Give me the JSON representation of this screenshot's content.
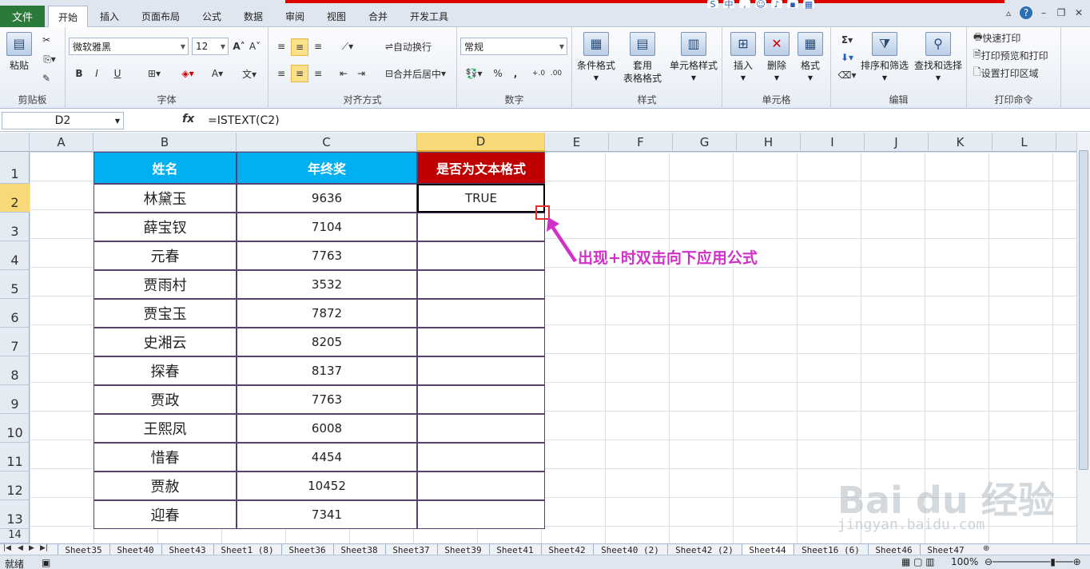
{
  "ribbon_tabs": {
    "file": "文件",
    "home": "开始",
    "insert": "插入",
    "page_layout": "页面布局",
    "formulas": "公式",
    "data": "数据",
    "review": "审阅",
    "view": "视图",
    "merge": "合并",
    "developer": "开发工具"
  },
  "clipboard": {
    "paste": "粘贴",
    "label": "剪贴板"
  },
  "font": {
    "name": "微软雅黑",
    "size": "12",
    "bold": "B",
    "italic": "I",
    "underline": "U",
    "label": "字体"
  },
  "alignment": {
    "wrap": "自动换行",
    "merge_center": "合并后居中",
    "label": "对齐方式"
  },
  "number": {
    "format": "常规",
    "percent": "%",
    "comma": ",",
    "label": "数字"
  },
  "styles": {
    "cond": "条件格式",
    "table_line1": "套用",
    "table_line2": "表格格式",
    "cell": "单元格样式",
    "label": "样式"
  },
  "cells_grp": {
    "insert": "插入",
    "delete": "删除",
    "format": "格式",
    "label": "单元格"
  },
  "editing": {
    "sort": "排序和筛选",
    "find": "查找和选择",
    "sum": "Σ",
    "label": "编辑"
  },
  "print": {
    "quick": "快速打印",
    "preview": "打印预览和打印",
    "area": "设置打印区域",
    "label": "打印命令"
  },
  "formula_bar": {
    "name_box": "D2",
    "fx": "fx",
    "formula": "=ISTEXT(C2)"
  },
  "columns": [
    "A",
    "B",
    "C",
    "D",
    "E",
    "F",
    "G",
    "H",
    "I",
    "J",
    "K",
    "L"
  ],
  "rows": [
    "1",
    "2",
    "3",
    "4",
    "5",
    "6",
    "7",
    "8",
    "9",
    "10",
    "11",
    "12",
    "13",
    "14"
  ],
  "table": {
    "headers": [
      "姓名",
      "年终奖",
      "是否为文本格式"
    ],
    "header_colors": [
      "#00b0f0",
      "#00b0f0",
      "#c00000"
    ],
    "data": [
      [
        "林黛玉",
        "9636",
        "TRUE"
      ],
      [
        "薛宝钗",
        "7104",
        ""
      ],
      [
        "元春",
        "7763",
        ""
      ],
      [
        "贾雨村",
        "3532",
        ""
      ],
      [
        "贾宝玉",
        "7872",
        ""
      ],
      [
        "史湘云",
        "8205",
        ""
      ],
      [
        "探春",
        "8137",
        ""
      ],
      [
        "贾政",
        "7763",
        ""
      ],
      [
        "王熙凤",
        "6008",
        ""
      ],
      [
        "惜春",
        "4454",
        ""
      ],
      [
        "贾赦",
        "10452",
        ""
      ],
      [
        "迎春",
        "7341",
        ""
      ]
    ]
  },
  "annotation": "出现+时双击向下应用公式",
  "annotation_color": "#d030c8",
  "sheets": [
    "Sheet35",
    "Sheet40",
    "Sheet43",
    "Sheet1 (8)",
    "Sheet36",
    "Sheet38",
    "Sheet37",
    "Sheet39",
    "Sheet41",
    "Sheet42",
    "Sheet40 (2)",
    "Sheet42 (2)",
    "Sheet44",
    "Sheet16 (6)",
    "Sheet46",
    "Sheet47"
  ],
  "active_sheet": "Sheet44",
  "status": {
    "ready": "就绪",
    "zoom": "100%"
  },
  "watermark": {
    "logo": "Bai du 经验",
    "url": "jingyan.baidu.com"
  }
}
